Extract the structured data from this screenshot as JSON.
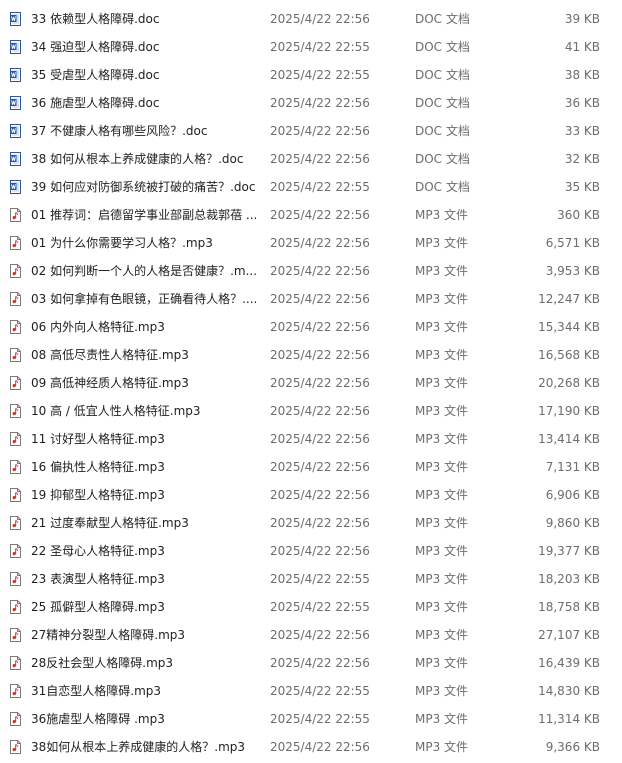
{
  "files": [
    {
      "name": "33 依赖型人格障碍.doc",
      "date": "2025/4/22 22:56",
      "type": "DOC 文档",
      "size": "39 KB",
      "icon": "word-doc-icon"
    },
    {
      "name": "34 强迫型人格障碍.doc",
      "date": "2025/4/22 22:55",
      "type": "DOC 文档",
      "size": "41 KB",
      "icon": "word-doc-icon"
    },
    {
      "name": "35 受虐型人格障碍.doc",
      "date": "2025/4/22 22:55",
      "type": "DOC 文档",
      "size": "38 KB",
      "icon": "word-doc-icon"
    },
    {
      "name": "36 施虐型人格障碍.doc",
      "date": "2025/4/22 22:56",
      "type": "DOC 文档",
      "size": "36 KB",
      "icon": "word-doc-icon"
    },
    {
      "name": "37 不健康人格有哪些风险？.doc",
      "date": "2025/4/22 22:56",
      "type": "DOC 文档",
      "size": "33 KB",
      "icon": "word-doc-icon"
    },
    {
      "name": "38 如何从根本上养成健康的人格？.doc",
      "date": "2025/4/22 22:56",
      "type": "DOC 文档",
      "size": "32 KB",
      "icon": "word-doc-icon"
    },
    {
      "name": "39 如何应对防御系统被打破的痛苦？.doc",
      "date": "2025/4/22 22:55",
      "type": "DOC 文档",
      "size": "35 KB",
      "icon": "word-doc-icon"
    },
    {
      "name": "01 推荐词：启德留学事业部副总裁郭蓓 ...",
      "date": "2025/4/22 22:56",
      "type": "MP3 文件",
      "size": "360 KB",
      "icon": "mp3-file-icon"
    },
    {
      "name": "01 为什么你需要学习人格？.mp3",
      "date": "2025/4/22 22:56",
      "type": "MP3 文件",
      "size": "6,571 KB",
      "icon": "mp3-file-icon"
    },
    {
      "name": "02 如何判断一个人的人格是否健康？.m...",
      "date": "2025/4/22 22:56",
      "type": "MP3 文件",
      "size": "3,953 KB",
      "icon": "mp3-file-icon"
    },
    {
      "name": "03 如何拿掉有色眼镜，正确看待人格？....",
      "date": "2025/4/22 22:56",
      "type": "MP3 文件",
      "size": "12,247 KB",
      "icon": "mp3-file-icon"
    },
    {
      "name": "06 内外向人格特征.mp3",
      "date": "2025/4/22 22:56",
      "type": "MP3 文件",
      "size": "15,344 KB",
      "icon": "mp3-file-icon"
    },
    {
      "name": "08 高低尽责性人格特征.mp3",
      "date": "2025/4/22 22:56",
      "type": "MP3 文件",
      "size": "16,568 KB",
      "icon": "mp3-file-icon"
    },
    {
      "name": "09 高低神经质人格特征.mp3",
      "date": "2025/4/22 22:56",
      "type": "MP3 文件",
      "size": "20,268 KB",
      "icon": "mp3-file-icon"
    },
    {
      "name": "10 高 / 低宜人性人格特征.mp3",
      "date": "2025/4/22 22:56",
      "type": "MP3 文件",
      "size": "17,190 KB",
      "icon": "mp3-file-icon"
    },
    {
      "name": "11 讨好型人格特征.mp3",
      "date": "2025/4/22 22:56",
      "type": "MP3 文件",
      "size": "13,414 KB",
      "icon": "mp3-file-icon"
    },
    {
      "name": "16 偏执性人格特征.mp3",
      "date": "2025/4/22 22:56",
      "type": "MP3 文件",
      "size": "7,131 KB",
      "icon": "mp3-file-icon"
    },
    {
      "name": "19 抑郁型人格特征.mp3",
      "date": "2025/4/22 22:56",
      "type": "MP3 文件",
      "size": "6,906 KB",
      "icon": "mp3-file-icon"
    },
    {
      "name": "21 过度奉献型人格特征.mp3",
      "date": "2025/4/22 22:56",
      "type": "MP3 文件",
      "size": "9,860 KB",
      "icon": "mp3-file-icon"
    },
    {
      "name": "22 圣母心人格特征.mp3",
      "date": "2025/4/22 22:56",
      "type": "MP3 文件",
      "size": "19,377 KB",
      "icon": "mp3-file-icon"
    },
    {
      "name": "23 表演型人格特征.mp3",
      "date": "2025/4/22 22:55",
      "type": "MP3 文件",
      "size": "18,203 KB",
      "icon": "mp3-file-icon"
    },
    {
      "name": "25 孤僻型人格障碍.mp3",
      "date": "2025/4/22 22:55",
      "type": "MP3 文件",
      "size": "18,758 KB",
      "icon": "mp3-file-icon"
    },
    {
      "name": "27精神分裂型人格障碍.mp3",
      "date": "2025/4/22 22:56",
      "type": "MP3 文件",
      "size": "27,107 KB",
      "icon": "mp3-file-icon"
    },
    {
      "name": "28反社会型人格障碍.mp3",
      "date": "2025/4/22 22:56",
      "type": "MP3 文件",
      "size": "16,439 KB",
      "icon": "mp3-file-icon"
    },
    {
      "name": "31自恋型人格障碍.mp3",
      "date": "2025/4/22 22:55",
      "type": "MP3 文件",
      "size": "14,830 KB",
      "icon": "mp3-file-icon"
    },
    {
      "name": "36施虐型人格障碍 .mp3",
      "date": "2025/4/22 22:55",
      "type": "MP3 文件",
      "size": "11,314 KB",
      "icon": "mp3-file-icon"
    },
    {
      "name": "38如何从根本上养成健康的人格？.mp3",
      "date": "2025/4/22 22:56",
      "type": "MP3 文件",
      "size": "9,366 KB",
      "icon": "mp3-file-icon"
    }
  ],
  "colors": {
    "doc_blue": "#2b579a",
    "doc_light": "#d6e4f5",
    "mp3_red": "#c0392b",
    "mp3_border": "#7a7a7a"
  }
}
